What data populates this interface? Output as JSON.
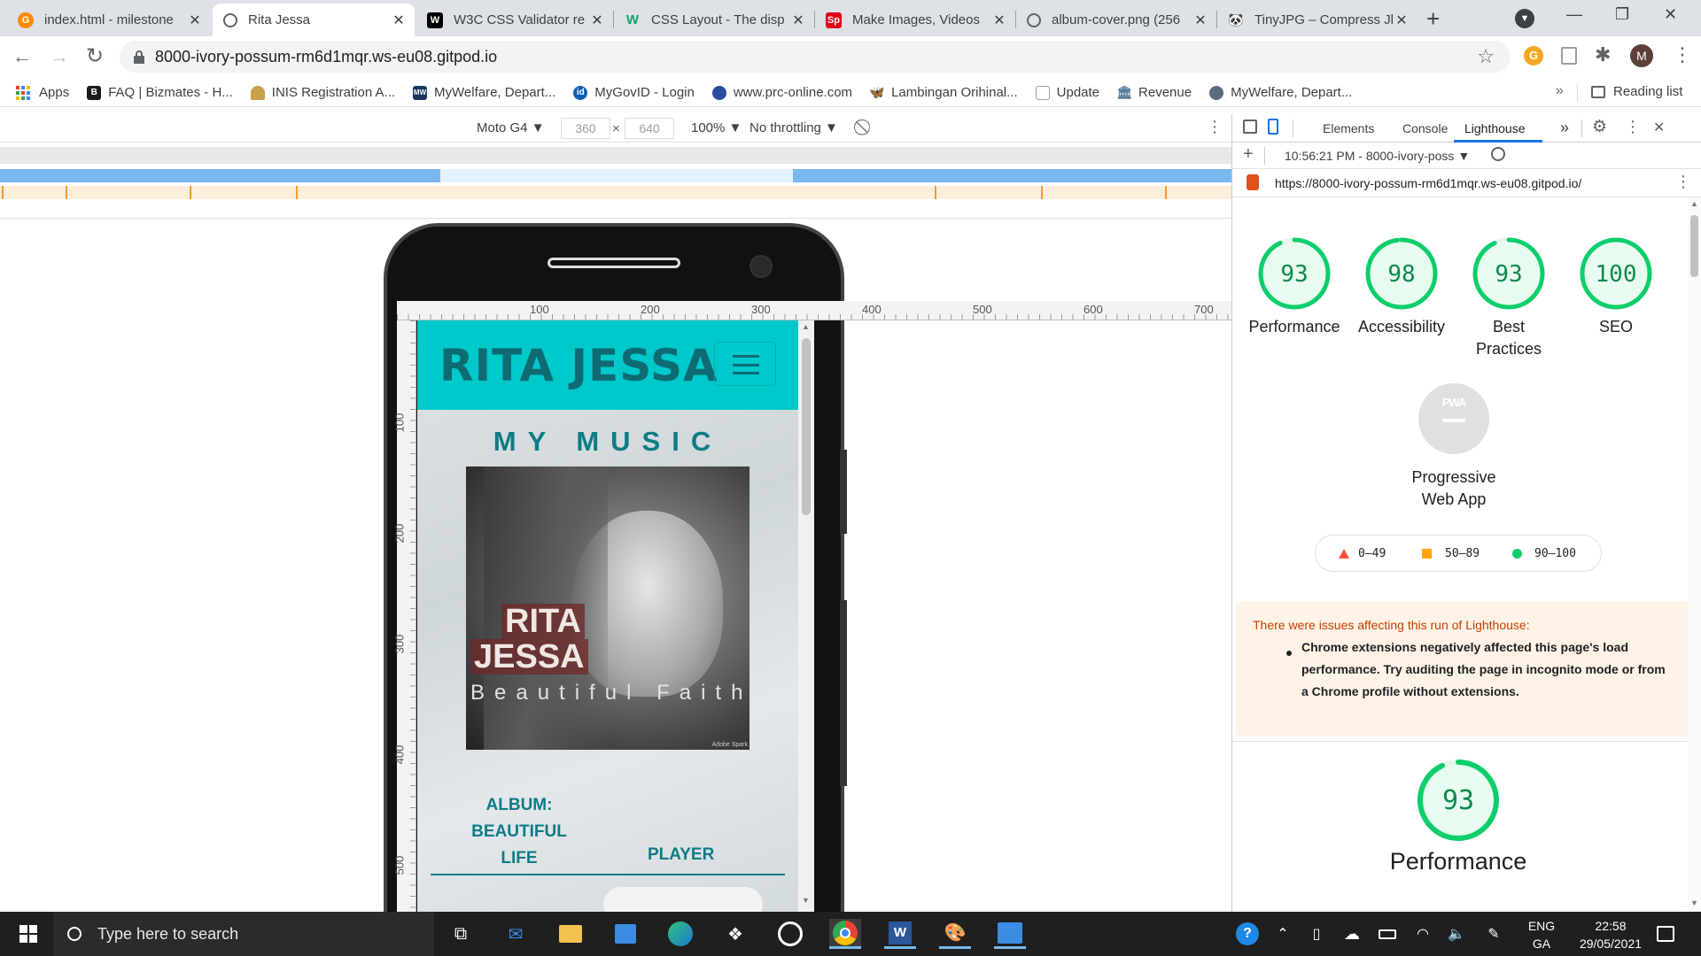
{
  "tabs": [
    {
      "title": "index.html - milestone",
      "favicon": "gitpod-icon",
      "color": "#ff8a00",
      "active": false
    },
    {
      "title": "Rita Jessa",
      "favicon": "globe-icon",
      "color": "#5f6368",
      "active": true
    },
    {
      "title": "W3C CSS Validator re",
      "favicon": "w3c-icon",
      "color": "#000000",
      "active": false
    },
    {
      "title": "CSS Layout - The disp",
      "favicon": "w3schools-icon",
      "color": "#04aa6d",
      "active": false
    },
    {
      "title": "Make Images, Videos",
      "favicon": "spark-icon",
      "color": "#e3001b",
      "active": false
    },
    {
      "title": "album-cover.png (256",
      "favicon": "globe-icon",
      "color": "#5f6368",
      "active": false
    },
    {
      "title": "TinyJPG – Compress Jl",
      "favicon": "panda-icon",
      "color": "#333333",
      "active": false
    }
  ],
  "window_controls": {
    "minimize": "—",
    "maximize": "❐",
    "close": "✕"
  },
  "address_bar": {
    "url": "8000-ivory-possum-rm6d1mqr.ws-eu08.gitpod.io"
  },
  "profile_initial": "M",
  "bookmarks": [
    {
      "label": "Apps",
      "icon": "apps-grid-icon",
      "color": "#4285f4"
    },
    {
      "label": "FAQ | Bizmates - H...",
      "icon": "b-icon",
      "color": "#1a1a1a",
      "badge": "B"
    },
    {
      "label": "INIS Registration A...",
      "icon": "harp-icon",
      "color": "#c8a24a"
    },
    {
      "label": "MyWelfare, Depart...",
      "icon": "mw-icon",
      "color": "#1b365d",
      "badge": "MW"
    },
    {
      "label": "MyGovID - Login",
      "icon": "id-icon",
      "color": "#0d5fb3",
      "badge": "id"
    },
    {
      "label": "www.prc-online.com",
      "icon": "seal-icon",
      "color": "#2b4da0"
    },
    {
      "label": "Lambingan Orihinal...",
      "icon": "butterfly-icon",
      "color": "#d35400"
    },
    {
      "label": "Update",
      "icon": "doc-icon",
      "color": "#9e9e9e"
    },
    {
      "label": "Revenue",
      "icon": "revenue-icon",
      "color": "#5a7d9a"
    },
    {
      "label": "MyWelfare, Depart...",
      "icon": "welfare-icon",
      "color": "#5a6b7d"
    }
  ],
  "reading_list": "Reading list",
  "device_toolbar": {
    "device": "Moto G4 ▼",
    "width": "360",
    "height": "640",
    "times": "×",
    "zoom": "100% ▼",
    "throttling": "No throttling ▼"
  },
  "ruler_ticks": [
    "100",
    "200",
    "300",
    "400",
    "500",
    "600",
    "700"
  ],
  "ruler_v_ticks": [
    "100",
    "200",
    "300",
    "400",
    "500"
  ],
  "site": {
    "brand": "RITA JESSA",
    "section_title": "MY MUSIC",
    "album_text_1": "RITA",
    "album_text_2": "JESSA",
    "album_subtitle": "Beautiful Faith",
    "album_label": "ALBUM: BEAUTIFUL LIFE",
    "player_label": "PLAYER",
    "watermark": "Adobe Spark",
    "brand_color": "#00c9cc",
    "heading_color": "#0e7c86"
  },
  "devtools": {
    "tabs": [
      "Elements",
      "Console",
      "Lighthouse"
    ],
    "active_tab": "Lighthouse",
    "more": "»",
    "report_time": "10:56:21 PM - 8000-ivory-poss ▼",
    "report_url": "https://8000-ivory-possum-rm6d1mqr.ws-eu08.gitpod.io/",
    "scores": [
      {
        "label": "Performance",
        "value": 93
      },
      {
        "label": "Accessibility",
        "value": 98
      },
      {
        "label": "Best Practices",
        "value": 93
      },
      {
        "label": "SEO",
        "value": 100
      }
    ],
    "pwa_badge": "PWA",
    "pwa_label": "Progressive Web App",
    "legend": [
      {
        "range": "0–49",
        "color": "#ff4e42",
        "shape": "triangle"
      },
      {
        "range": "50–89",
        "color": "#ffa400",
        "shape": "square"
      },
      {
        "range": "90–100",
        "color": "#0cce6b",
        "shape": "circle"
      }
    ],
    "warning_title": "There were issues affecting this run of Lighthouse:",
    "warning_item": "Chrome extensions negatively affected this page's load performance. Try auditing the page in incognito mode or from a Chrome profile without extensions.",
    "big_score": {
      "value": 93,
      "label": "Performance"
    },
    "pass_color": "#0cce6b"
  },
  "taskbar": {
    "search_placeholder": "Type here to search",
    "lang_1": "ENG",
    "lang_2": "GA",
    "time": "22:58",
    "date": "29/05/2021"
  }
}
